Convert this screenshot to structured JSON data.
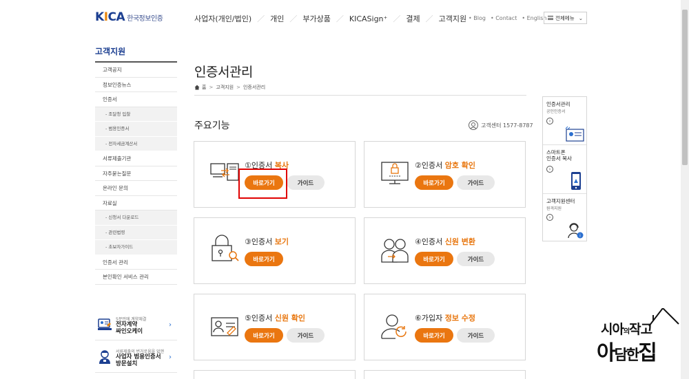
{
  "header": {
    "logo_mark_k": "K",
    "logo_mark_i": "I",
    "logo_mark_ca": "CA",
    "logo_text": "한국정보인증",
    "gnb": [
      "사업자(개인/법인)",
      "개인",
      "부가상품",
      "KICASign⁺",
      "결제",
      "고객지원"
    ],
    "util": [
      "• Blog",
      "• Contact",
      "• English"
    ],
    "all_menu": "전체메뉴",
    "all_menu_arrow": "⌄"
  },
  "sidebar": {
    "title": "고객지원",
    "items": [
      {
        "label": "고객공지",
        "sub": false
      },
      {
        "label": "정보인증뉴스",
        "sub": false
      },
      {
        "label": "인증서",
        "sub": false
      },
      {
        "label": "- 조달청 입찰",
        "sub": true
      },
      {
        "label": "- 범용인증서",
        "sub": true
      },
      {
        "label": "- 전자세금계산서",
        "sub": true
      },
      {
        "label": "서류제출기관",
        "sub": false
      },
      {
        "label": "자주묻는질문",
        "sub": false
      },
      {
        "label": "온라인 문의",
        "sub": false
      },
      {
        "label": "자료실",
        "sub": false
      },
      {
        "label": "- 신청서 다운로드",
        "sub": true
      },
      {
        "label": "- 관련법령",
        "sub": true
      },
      {
        "label": "- 초보자가이드",
        "sub": true
      },
      {
        "label": "인증서 관리",
        "sub": false
      },
      {
        "label": "본인확인 서비스 관리",
        "sub": false
      }
    ],
    "banners": [
      {
        "small": "5분만에 계약체결",
        "big1": "전자계약",
        "big2": "싸인오케이",
        "arrow": "›"
      },
      {
        "small": "서류제출의 번거로움을 없앤",
        "big1": "사업자 범용인증서",
        "big2": "방문설치",
        "arrow": "›"
      }
    ]
  },
  "content": {
    "page_title": "인증서관리",
    "breadcrumb": [
      "홈",
      "고객지원",
      "인증서관리"
    ],
    "breadcrumb_sep": ">",
    "section_title": "주요기능",
    "cs_label": "고객센터 1577-8787",
    "cards": [
      {
        "num": "①",
        "pre": "인증서 ",
        "hl": "복사",
        "go": "바로가기",
        "guide": "가이드"
      },
      {
        "num": "②",
        "pre": "인증서 ",
        "hl": "암호 확인",
        "go": "바로가기",
        "guide": "가이드"
      },
      {
        "num": "③",
        "pre": "인증서 ",
        "hl": "보기",
        "go": "바로가기"
      },
      {
        "num": "④",
        "pre": "인증서 ",
        "hl": "신원 변환",
        "go": "바로가기",
        "guide": "가이드"
      },
      {
        "num": "⑤",
        "pre": "인증서 ",
        "hl": "신원 확인",
        "go": "바로가기",
        "guide": "가이드"
      },
      {
        "num": "⑥",
        "pre": "가입자 ",
        "hl": "정보 수정",
        "go": "바로가기",
        "guide": "가이드"
      }
    ]
  },
  "quick_menu": [
    {
      "title1": "인증서관리",
      "title2": "",
      "sub": "공인인증서",
      "arrow": "›"
    },
    {
      "title1": "스마트폰",
      "title2": "인증서 복사",
      "sub": "",
      "arrow": "›"
    },
    {
      "title1": "고객지원센터",
      "title2": "",
      "sub": "원격지원",
      "arrow": "›"
    }
  ],
  "watermark": {
    "l1a": "시아",
    "l1b": "의",
    "l1c": "작고",
    "l2a": "아",
    "l2b": "담한",
    "l2c": "집"
  },
  "colors": {
    "brand_blue": "#1c3f91",
    "accent_orange": "#ea7610",
    "highlight_red": "#e00000"
  }
}
